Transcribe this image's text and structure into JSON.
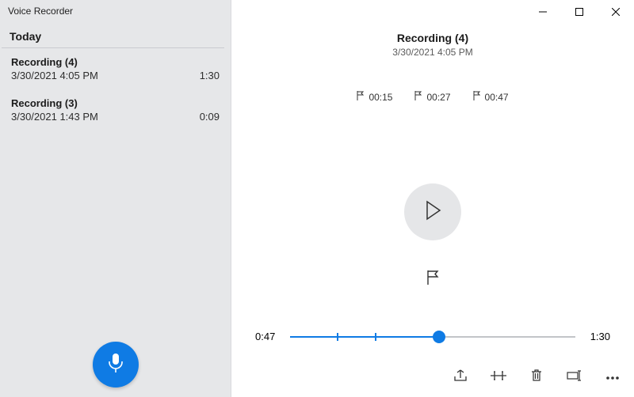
{
  "window": {
    "title": "Voice Recorder"
  },
  "sidebar": {
    "section_label": "Today",
    "recordings": [
      {
        "title": "Recording (4)",
        "timestamp": "3/30/2021 4:05 PM",
        "duration": "1:30"
      },
      {
        "title": "Recording (3)",
        "timestamp": "3/30/2021 1:43 PM",
        "duration": "0:09"
      }
    ]
  },
  "detail": {
    "title": "Recording (4)",
    "timestamp": "3/30/2021 4:05 PM",
    "markers": [
      "00:15",
      "00:27",
      "00:47"
    ],
    "playhead": {
      "current": "0:47",
      "total": "1:30",
      "position_seconds": 47,
      "total_seconds": 90
    }
  },
  "colors": {
    "accent": "#0f7be4"
  }
}
